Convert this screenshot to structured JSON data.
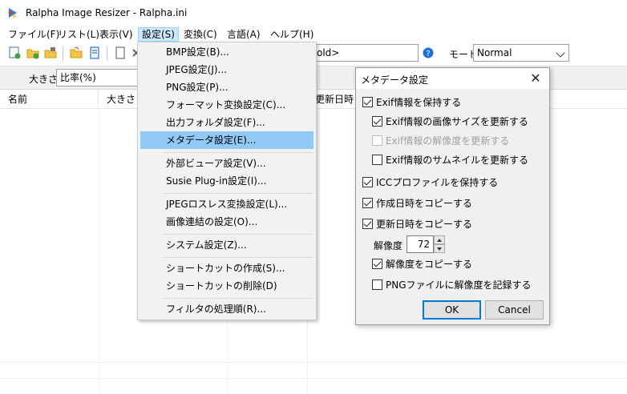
{
  "window": {
    "title": "Ralpha Image Resizer - Ralpha.ini"
  },
  "menubar": {
    "items": [
      "ファイル(F)",
      "リスト(L)",
      "表示(V)",
      "設定(S)",
      "変換(C)",
      "言語(A)",
      "ヘルプ(H)"
    ]
  },
  "toolbar": {
    "path_field": "old>",
    "mode_label": "モード",
    "mode_value": "Normal"
  },
  "toolbar2": {
    "size_label": "大きさ",
    "size_value": "比率(%)"
  },
  "listview": {
    "columns": [
      "名前",
      "大きさ",
      "",
      "更新日時"
    ]
  },
  "settings_menu": {
    "items": [
      "BMP設定(B)...",
      "JPEG設定(J)...",
      "PNG設定(P)...",
      "フォーマット変換設定(C)...",
      "出力フォルダ設定(F)...",
      "メタデータ設定(E)...",
      "外部ビューア設定(V)...",
      "Susie Plug-in設定(I)...",
      "JPEGロスレス変換設定(L)...",
      "画像連結の設定(O)...",
      "システム設定(Z)...",
      "ショートカットの作成(S)...",
      "ショートカットの削除(D)",
      "フィルタの処理順(R)..."
    ]
  },
  "dialog": {
    "title": "メタデータ設定",
    "close": "✕",
    "options": [
      {
        "label": "Exif情報を保持する",
        "checked": true,
        "disabled": false
      },
      {
        "label": "Exif情報の画像サイズを更新する",
        "checked": true,
        "disabled": false
      },
      {
        "label": "Exif情報の解像度を更新する",
        "checked": false,
        "disabled": true
      },
      {
        "label": "Exif情報のサムネイルを更新する",
        "checked": false,
        "disabled": false
      },
      {
        "label": "ICCプロファイルを保持する",
        "checked": true,
        "disabled": false
      },
      {
        "label": "作成日時をコピーする",
        "checked": true,
        "disabled": false
      },
      {
        "label": "更新日時をコピーする",
        "checked": true,
        "disabled": false
      },
      {
        "label": "解像度をコピーする",
        "checked": true,
        "disabled": false
      },
      {
        "label": "PNGファイルに解像度を記録する",
        "checked": false,
        "disabled": false
      }
    ],
    "resolution_label": "解像度",
    "resolution_value": "72",
    "ok": "OK",
    "cancel": "Cancel"
  },
  "colors": {
    "menu_highlight": "#91c9f7",
    "menubar_active": "#cce8ff",
    "default_button_border": "#0078d7"
  }
}
